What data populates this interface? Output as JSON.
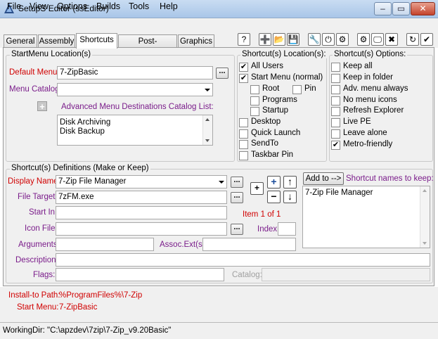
{
  "window": {
    "title": "SetupS Editor (ssEditor)",
    "min_glyph": "–",
    "max_glyph": "▭",
    "close_glyph": "✕"
  },
  "menu": [
    "File",
    "View",
    "Options",
    "Builds",
    "Tools",
    "Help"
  ],
  "tabs": [
    "General",
    "Assembly",
    "Shortcuts",
    "Post-processing",
    "Graphics"
  ],
  "toolbar": {
    "icons": [
      "?",
      "➕",
      "📂",
      "💾",
      "🔧",
      "⏻",
      "⚙",
      "⚙",
      "🖵",
      "✖",
      "↻",
      "✔"
    ]
  },
  "startmenu": {
    "group_title": "StartMenu Location(s)",
    "default_menu_label": "Default Menu",
    "default_menu_value": "7-ZipBasic",
    "menu_catalog_label": "Menu Catalog",
    "menu_catalog_value": "",
    "add_glyph": "+",
    "adv_label": "Advanced Menu Destinations Catalog List:",
    "adv_items": [
      "Disk Archiving",
      "Disk Backup"
    ]
  },
  "locations": {
    "group_title": "Shortcut(s) Location(s):",
    "items": [
      {
        "label": "All Users",
        "checked": true
      },
      {
        "label": "Start Menu (normal)",
        "checked": true
      },
      {
        "label": "Root",
        "checked": false
      },
      {
        "label": "Pin",
        "checked": false
      },
      {
        "label": "Programs",
        "checked": false
      },
      {
        "label": "Startup",
        "checked": false
      },
      {
        "label": "Desktop",
        "checked": false
      },
      {
        "label": "Quick Launch",
        "checked": false
      },
      {
        "label": "SendTo",
        "checked": false
      },
      {
        "label": "Taskbar Pin",
        "checked": false
      }
    ]
  },
  "options": {
    "group_title": "Shortcut(s) Options:",
    "items": [
      {
        "label": "Keep all",
        "checked": false
      },
      {
        "label": "Keep in folder",
        "checked": false
      },
      {
        "label": "Adv. menu always",
        "checked": false
      },
      {
        "label": "No menu icons",
        "checked": false
      },
      {
        "label": "Refresh Explorer",
        "checked": false
      },
      {
        "label": "Live PE",
        "checked": false
      },
      {
        "label": "Leave alone",
        "checked": false
      },
      {
        "label": "Metro-friendly",
        "checked": true
      }
    ]
  },
  "definitions": {
    "group_title": "Shortcut(s) Definitions (Make or Keep)",
    "display_name_label": "Display Name",
    "display_name_value": "7-Zip File Manager",
    "file_target_label": "File Target",
    "file_target_value": "7zFM.exe",
    "start_in_label": "Start In",
    "start_in_value": "",
    "icon_file_label": "Icon File",
    "icon_file_value": "",
    "arguments_label": "Arguments",
    "arguments_value": "",
    "assoc_label": "Assoc.Ext(s)",
    "assoc_value": "",
    "description_label": "Description",
    "description_value": "",
    "flags_label": "Flags:",
    "flags_value": "",
    "catalog_label": "Catalog:",
    "catalog_value": "",
    "item_word": "Item",
    "item_index": "1",
    "of_word": "of",
    "item_total": "1",
    "index_label": "Index",
    "index_value": "",
    "add_button": "Add to -->",
    "keep_label": "Shortcut names to keep:",
    "keep_items": [
      "7-Zip File Manager"
    ],
    "dots": "...",
    "plus_glyph": "+",
    "minus_glyph": "−",
    "up_glyph": "↑",
    "down_glyph": "↓",
    "new_glyph": "+"
  },
  "install": {
    "path_label": "Install-to Path:",
    "path_value": "%ProgramFiles%\\7-Zip",
    "menu_label": "Start Menu:",
    "menu_value": "7-ZipBasic"
  },
  "status": {
    "text": "WorkingDir: \"C:\\apzdev\\7zip\\7-Zip_v9.20Basic\""
  },
  "colors": {
    "label_red": "#d00000",
    "label_purple": "#7a1c8a",
    "titlebar": "#b8d0ec"
  }
}
